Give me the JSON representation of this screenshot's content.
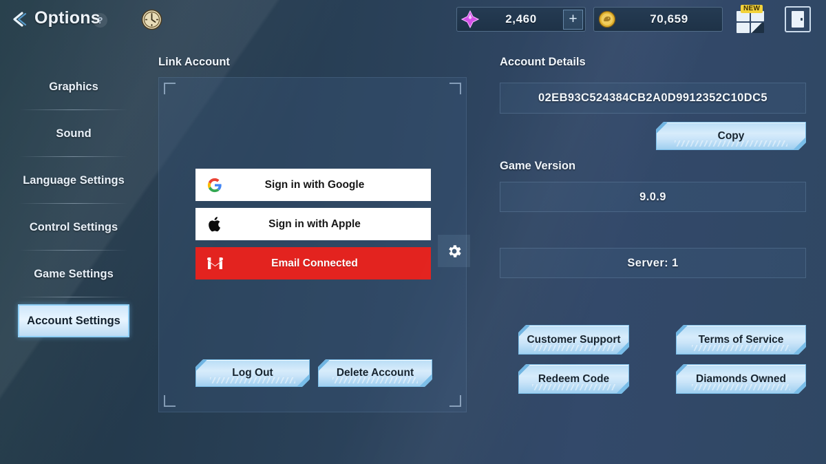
{
  "header": {
    "back_icon": "chevron-left-icon",
    "title": "Options",
    "help_label": "?",
    "clock_icon": "clock-icon",
    "grid_icon": "grid-menu-icon",
    "new_badge": "NEW",
    "exit_icon": "exit-door-icon",
    "currencies": [
      {
        "icon": "diamond-gem-icon",
        "value": "2,460",
        "plus_label": "+",
        "color": "#d451e8"
      },
      {
        "icon": "gold-coin-icon",
        "value": "70,659",
        "color": "#e0b230"
      }
    ]
  },
  "sidebar": {
    "items": [
      {
        "label": "Graphics",
        "active": false
      },
      {
        "label": "Sound",
        "active": false
      },
      {
        "label": "Language Settings",
        "active": false
      },
      {
        "label": "Control Settings",
        "active": false
      },
      {
        "label": "Game Settings",
        "active": false
      },
      {
        "label": "Account Settings",
        "active": true
      }
    ]
  },
  "link_account": {
    "heading": "Link Account",
    "signin_buttons": [
      {
        "icon": "google-icon",
        "label": "Sign in with Google",
        "style": "white"
      },
      {
        "icon": "apple-icon",
        "label": "Sign in with Apple",
        "style": "white"
      },
      {
        "icon": "gmail-icon",
        "label": "Email Connected",
        "style": "red"
      }
    ],
    "gear_icon": "gear-icon",
    "actions": [
      {
        "label": "Log Out"
      },
      {
        "label": "Delete Account"
      }
    ]
  },
  "account_details": {
    "heading": "Account Details",
    "account_id": "02EB93C524384CB2A0D9912352C10DC5",
    "copy_label": "Copy",
    "version_heading": "Game Version",
    "version_value": "9.0.9",
    "server_value": "Server: 1",
    "links": [
      {
        "label": "Customer Support"
      },
      {
        "label": "Terms of Service"
      },
      {
        "label": "Redeem Code"
      },
      {
        "label": "Diamonds Owned"
      }
    ]
  },
  "theme": {
    "accent_blue": "#8fd0f7",
    "button_blue": "#cbe5f9",
    "email_red": "#e3231f",
    "badge_yellow": "#f2d23a"
  }
}
